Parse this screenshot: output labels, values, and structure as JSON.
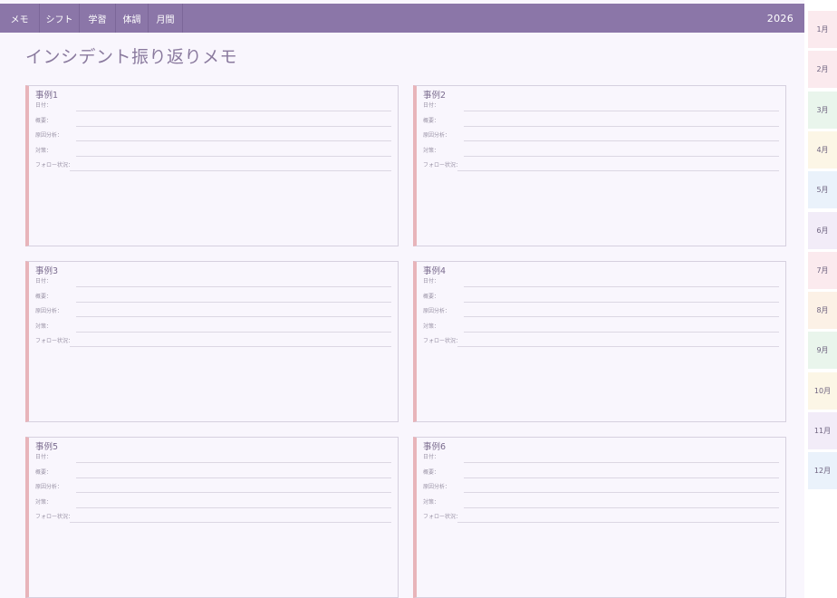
{
  "nav": {
    "tabs": [
      "メモ",
      "シフト",
      "学習",
      "体調",
      "月間"
    ],
    "year": "2026"
  },
  "title": "インシデント振り返りメモ",
  "fields": [
    "日付：",
    "概要：",
    "原因分析：",
    "対策：",
    "フォロー状況："
  ],
  "cases": [
    {
      "title": "事例1"
    },
    {
      "title": "事例2"
    },
    {
      "title": "事例3"
    },
    {
      "title": "事例4"
    },
    {
      "title": "事例5"
    },
    {
      "title": "事例6"
    }
  ],
  "months": [
    {
      "label": "1月",
      "color": "#fbeaee"
    },
    {
      "label": "2月",
      "color": "#fbeaee"
    },
    {
      "label": "3月",
      "color": "#e9f5ec"
    },
    {
      "label": "4月",
      "color": "#fcf6e6"
    },
    {
      "label": "5月",
      "color": "#eaf2fb"
    },
    {
      "label": "6月",
      "color": "#f2ecf8"
    },
    {
      "label": "7月",
      "color": "#fbeaee"
    },
    {
      "label": "8月",
      "color": "#fcf1e6"
    },
    {
      "label": "9月",
      "color": "#e9f5ec"
    },
    {
      "label": "10月",
      "color": "#fcf6e6"
    },
    {
      "label": "11月",
      "color": "#f2ecf8"
    },
    {
      "label": "12月",
      "color": "#eaf2fb"
    }
  ],
  "colors": {
    "nav": "#8b76a8",
    "accent_border": "#e8b4ba",
    "page_bg": "#f9f6fd"
  }
}
